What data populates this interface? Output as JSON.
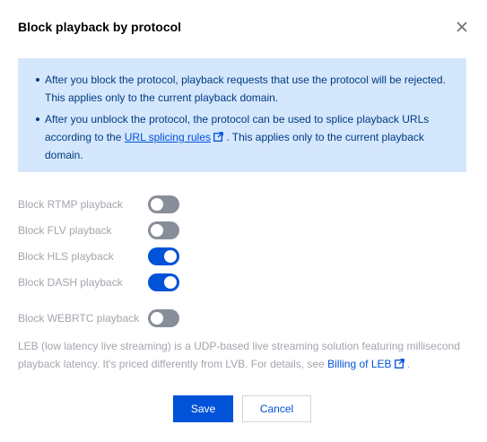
{
  "dialog": {
    "title": "Block playback by protocol"
  },
  "info": {
    "item1": "After you block the protocol, playback requests that use the protocol will be rejected. This applies only to the current playback domain.",
    "item2_before": "After you unblock the protocol, the protocol can be used to splice playback URLs according to the ",
    "item2_link": "URL splicing rules",
    "item2_after": " . This applies only to the current playback domain."
  },
  "toggles": [
    {
      "label": "Block RTMP playback",
      "on": false
    },
    {
      "label": "Block FLV playback",
      "on": false
    },
    {
      "label": "Block HLS playback",
      "on": true
    },
    {
      "label": "Block DASH playback",
      "on": true
    },
    {
      "label": "Block WEBRTC playback",
      "on": false
    }
  ],
  "description": {
    "text": "LEB (low latency live streaming) is a UDP-based live streaming solution featuring millisecond playback latency. It's priced differently from LVB. For details, see ",
    "link": "Billing of LEB",
    "after": " ."
  },
  "buttons": {
    "save": "Save",
    "cancel": "Cancel"
  },
  "colors": {
    "primary": "#0052d9",
    "info_bg": "#d5e7fd",
    "toggle_off": "#888e99"
  },
  "icons": {
    "close": "close-icon",
    "external_link": "external-link-icon"
  }
}
